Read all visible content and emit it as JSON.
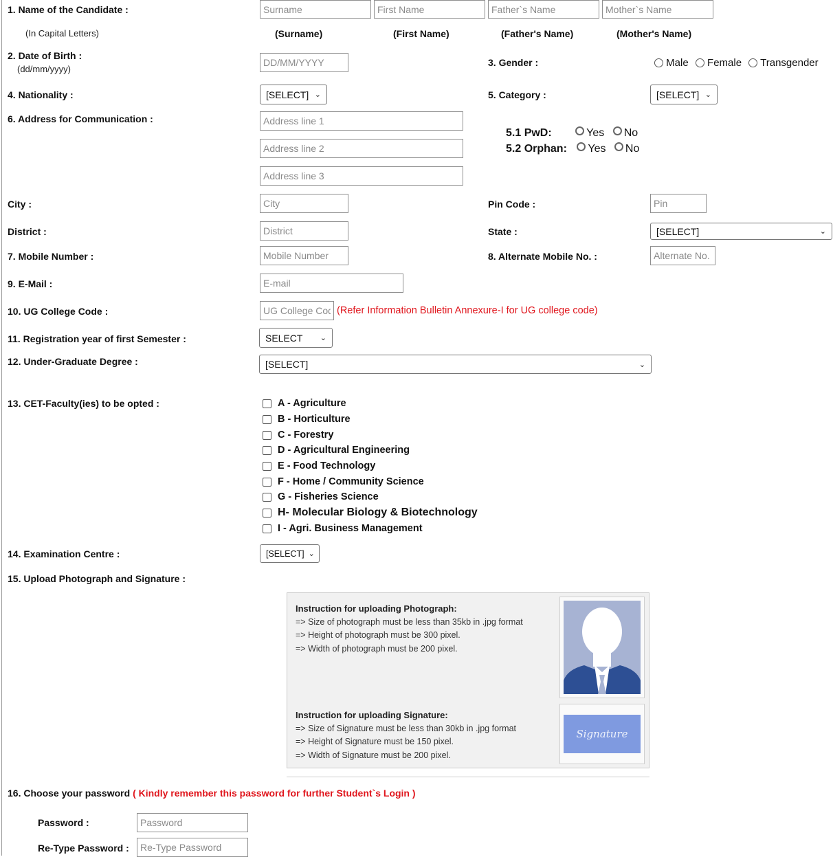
{
  "q1": {
    "label": "1. Name of the Candidate :",
    "note": "(In Capital Letters)",
    "placeholders": {
      "surname": "Surname",
      "first": "First Name",
      "father": "Father`s Name",
      "mother": "Mother`s Name"
    },
    "headers": {
      "surname": "(Surname)",
      "first": "(First Name)",
      "father": "(Father's Name)",
      "mother": "(Mother's Name)"
    }
  },
  "q2": {
    "label": "2. Date of Birth :",
    "note": "(dd/mm/yyyy)",
    "placeholder": "DD/MM/YYYY"
  },
  "q3": {
    "label": "3. Gender :",
    "options": [
      "Male",
      "Female",
      "Transgender"
    ]
  },
  "q4": {
    "label": "4. Nationality :",
    "selected": "[SELECT]"
  },
  "q5": {
    "label": "5. Category :",
    "selected": "[SELECT]"
  },
  "q5_1": {
    "label": "5.1 PwD:",
    "yes": "Yes",
    "no": "No"
  },
  "q5_2": {
    "label": "5.2 Orphan:",
    "yes": "Yes",
    "no": "No"
  },
  "q6": {
    "label": "6. Address for Communication :",
    "line1": "Address line 1",
    "line2": "Address line 2",
    "line3": "Address line 3"
  },
  "city": {
    "label": "City :",
    "placeholder": "City"
  },
  "pin": {
    "label": "Pin Code :",
    "placeholder": "Pin"
  },
  "district": {
    "label": "District :",
    "placeholder": "District"
  },
  "state": {
    "label": "State :",
    "selected": "[SELECT]"
  },
  "q7": {
    "label": "7. Mobile Number :",
    "placeholder": "Mobile Number"
  },
  "q8": {
    "label": "8. Alternate Mobile No. :",
    "placeholder": "Alternate No."
  },
  "q9": {
    "label": "9. E-Mail :",
    "placeholder": "E-mail"
  },
  "q10": {
    "label": "10. UG College Code :",
    "placeholder": "UG College Code",
    "note": "(Refer Information Bulletin Annexure-I for UG college code)"
  },
  "q11": {
    "label": "11. Registration year of first Semester :",
    "selected": "SELECT"
  },
  "q12": {
    "label": "12. Under-Graduate Degree :",
    "selected": "[SELECT]"
  },
  "q13": {
    "label": "13. CET-Faculty(ies) to be opted :",
    "options": [
      "A - Agriculture",
      "B - Horticulture",
      "C - Forestry",
      "D - Agricultural Engineering",
      "E - Food Technology",
      "F - Home / Community Science",
      "G - Fisheries Science",
      "H- Molecular Biology & Biotechnology",
      "I - Agri. Business Management"
    ]
  },
  "q14": {
    "label": "14. Examination Centre :",
    "selected": "[SELECT]"
  },
  "q15": {
    "label": "15. Upload Photograph and Signature :",
    "photo_title": "Instruction for uploading Photograph:",
    "photo_lines": [
      "=> Size of photograph must be less than 35kb in .jpg format",
      "=> Height of photograph must be 300 pixel.",
      "=> Width of photograph must be 200 pixel."
    ],
    "sig_title": "Instruction for uploading Signature:",
    "sig_lines": [
      "=> Size of Signature must be less than 30kb in .jpg format",
      "=> Height of Signature must be 150 pixel.",
      "=> Width of Signature must be 200 pixel."
    ],
    "sig_image_text": "Signature"
  },
  "q16": {
    "label": "16. Choose your password",
    "note": "( Kindly remember this password for further Student`s Login )",
    "password_label": "Password :",
    "password_placeholder": "Password",
    "retype_label": "Re-Type Password :",
    "retype_placeholder": "Re-Type Password"
  },
  "colors": {
    "accent_red": "#e0161d",
    "photo_bg": "#a7b3d3",
    "signature_bg": "#7f9ae0"
  }
}
